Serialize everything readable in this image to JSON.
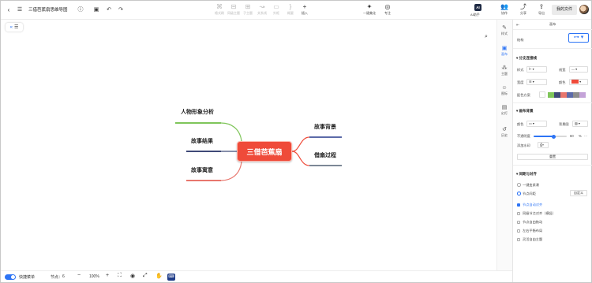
{
  "header": {
    "doc_title": "三借芭蕉扇思维导图",
    "tools": [
      {
        "label": "格式刷",
        "icon": "format-brush-icon",
        "glyph": "⌘",
        "enabled": false
      },
      {
        "label": "同级主题",
        "icon": "sibling-topic-icon",
        "glyph": "⊟",
        "enabled": false
      },
      {
        "label": "子主题",
        "icon": "subtopic-icon",
        "glyph": "⊞",
        "enabled": false
      },
      {
        "label": "关系线",
        "icon": "relation-line-icon",
        "glyph": "↝",
        "enabled": false
      },
      {
        "label": "外框",
        "icon": "boundary-icon",
        "glyph": "▭",
        "enabled": false
      },
      {
        "label": "概要",
        "icon": "summary-icon",
        "glyph": "}",
        "enabled": false
      },
      {
        "label": "插入",
        "icon": "insert-icon",
        "glyph": "+",
        "enabled": true
      },
      {
        "label": "一键美化",
        "icon": "magic-wand-icon",
        "glyph": "✦",
        "enabled": true
      },
      {
        "label": "专注",
        "icon": "focus-icon",
        "glyph": "◎",
        "enabled": true
      }
    ],
    "ai_badge": "AI",
    "ai_label": "AI助手",
    "right_tools": [
      {
        "label": "协作",
        "icon": "collaborate-icon",
        "glyph": "👥"
      },
      {
        "label": "分享",
        "icon": "share-icon",
        "glyph": "⤴"
      },
      {
        "label": "导出",
        "icon": "export-icon",
        "glyph": "⇪"
      }
    ],
    "my_files": "我的文件"
  },
  "mindmap": {
    "root": "三借芭蕉扇",
    "left_topics": [
      {
        "label": "人物形象分析",
        "color": "#7fc55a"
      },
      {
        "label": "故事结果",
        "color": "#3f4a78"
      },
      {
        "label": "故事寓意",
        "color": "#e8766d"
      }
    ],
    "right_topics": [
      {
        "label": "故事背景",
        "color": "#5c6aa8"
      },
      {
        "label": "借扇过程",
        "color": "#7c8896"
      }
    ],
    "branch_colors": {
      "left": "#7fc55a",
      "left_mid": "#e8766d",
      "right": "#ef4b3a"
    }
  },
  "sidebar_strip": [
    {
      "label": "样式",
      "icon": "style-icon",
      "glyph": "✎",
      "active": false
    },
    {
      "label": "画布",
      "icon": "canvas-icon",
      "glyph": "▣",
      "active": true
    },
    {
      "label": "主题",
      "icon": "theme-icon",
      "glyph": "⁂",
      "active": false
    },
    {
      "label": "图标",
      "icon": "emoji-icon",
      "glyph": "☺",
      "active": false
    },
    {
      "label": "幻灯",
      "icon": "slides-icon",
      "glyph": "▤",
      "active": false
    },
    {
      "label": "历史",
      "icon": "history-icon",
      "glyph": "↺",
      "active": false
    }
  ],
  "panel": {
    "title": "画布",
    "structure_label": "结构",
    "branch_section": "分支连接线",
    "style_label": "样式",
    "linewidth_label": "线宽",
    "width_label": "宽度",
    "color_label": "颜色",
    "branch_color": "#ef4b3a",
    "color_scheme_label": "配色方案",
    "scheme_colors": [
      "#7fc55a",
      "#3f4a78",
      "#e8766d",
      "#5c6aa8",
      "#8d8d8d",
      "#c4a3d8"
    ],
    "canvas_bg_section": "画布背景",
    "bg_color_label": "颜色",
    "bg_image_label": "背景图",
    "opacity_label": "不透明度",
    "opacity_value": "60",
    "opacity_unit": "%",
    "opacity_fraction": 0.6,
    "add_watermark": "添加水印",
    "reset": "重置",
    "layout_section": "间距与对齐",
    "auto_spacing": "一键变紧凑",
    "node_spacing": "节点间距",
    "custom": "自定义",
    "options": [
      {
        "label": "节点自动对齐",
        "checked": true
      },
      {
        "label": "同级节点对齐（横竖）",
        "checked": false
      },
      {
        "label": "节点自由拖动",
        "checked": false
      },
      {
        "label": "左右平衡布局",
        "checked": false
      },
      {
        "label": "灵活自由主题",
        "checked": false
      }
    ]
  },
  "footer": {
    "quick_mode": "快捷菜单",
    "node_count_label": "节点：",
    "node_count": "6",
    "zoom": "100%"
  }
}
